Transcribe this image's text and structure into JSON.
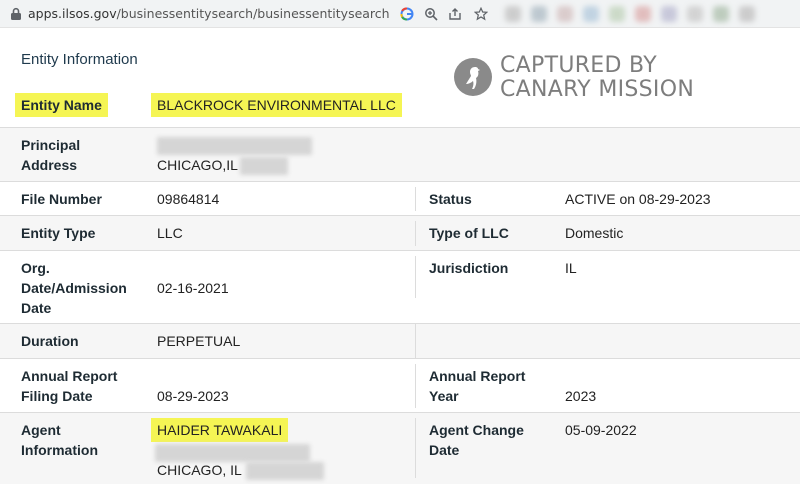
{
  "browser": {
    "url_host": "apps.ilsos.gov",
    "url_path": "/businessentitysearch/businessentitysearch",
    "icons": [
      "lock-icon",
      "google-icon",
      "zoom-icon",
      "share-icon",
      "star-icon"
    ]
  },
  "page": {
    "section_title": "Entity Information"
  },
  "watermark": {
    "line1": "CAPTURED BY",
    "line2": "CANARY MISSION"
  },
  "fields": {
    "entity_name": {
      "label": "Entity Name",
      "value": "BLACKROCK ENVIRONMENTAL LLC"
    },
    "principal_address": {
      "label_line1": "Principal",
      "label_line2": "Address",
      "city": "CHICAGO,IL"
    },
    "file_number": {
      "label": "File Number",
      "value": "09864814"
    },
    "status": {
      "label": "Status",
      "value": "ACTIVE on 08-29-2023"
    },
    "entity_type": {
      "label": "Entity Type",
      "value": "LLC"
    },
    "type_of_llc": {
      "label": "Type of LLC",
      "value": "Domestic"
    },
    "org_date": {
      "label_line1": "Org.",
      "label_line2": "Date/Admission",
      "label_line3": "Date",
      "value": "02-16-2021"
    },
    "jurisdiction": {
      "label": "Jurisdiction",
      "value": "IL"
    },
    "duration": {
      "label": "Duration",
      "value": "PERPETUAL"
    },
    "annual_report_filing": {
      "label_line1": "Annual Report",
      "label_line2": "Filing Date",
      "value": "08-29-2023"
    },
    "annual_report_year": {
      "label_line1": "Annual Report",
      "label_line2": "Year",
      "value": "2023"
    },
    "agent_info": {
      "label_line1": "Agent",
      "label_line2": "Information",
      "name": "HAIDER TAWAKALI",
      "city": "CHICAGO, IL"
    },
    "agent_change": {
      "label_line1": "Agent Change",
      "label_line2": "Date",
      "value": "05-09-2022"
    }
  },
  "colors": {
    "highlight": "#f5f554",
    "row_gray": "#f6f6f6",
    "watermark": "#7d7d7d"
  }
}
